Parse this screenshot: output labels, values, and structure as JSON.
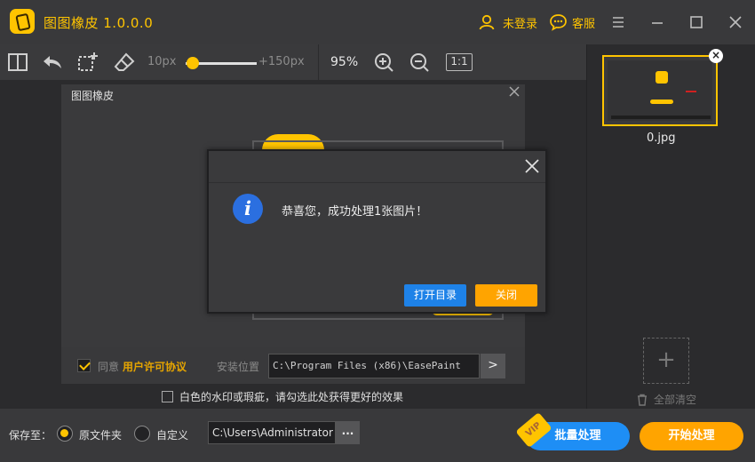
{
  "app": {
    "title": "图图橡皮 1.0.0.0"
  },
  "titlebar": {
    "login_label": "未登录",
    "service_label": "客服"
  },
  "toolbar": {
    "brush_min": "10px",
    "brush_max": "+150px",
    "brush_level": 0.1,
    "zoom": "95%",
    "ratio_label": "1:1"
  },
  "inner_dialog": {
    "title": "图图橡皮",
    "agree_prefix": "同意",
    "license_link": "用户许可协议",
    "install_label": "安装位置",
    "install_path": "C:\\Program Files (x86)\\EasePaint",
    "install_browse": ">"
  },
  "watermark_hint": "白色的水印或瑕疵，请勾选此处获得更好的效果",
  "right_panel": {
    "thumbnail_name": "0.jpg",
    "add_label": "+",
    "clear_all": "全部清空"
  },
  "bottombar": {
    "save_label": "保存至：",
    "option_original": "原文件夹",
    "option_custom": "自定义",
    "output_path": "C:\\Users\\Administrator",
    "output_browse": "...",
    "batch_label": "批量处理",
    "vip_label": "VIP",
    "start_label": "开始处理"
  },
  "modal": {
    "message": "恭喜您，成功处理1张图片！",
    "open_dir_label": "打开目录",
    "close_label": "关闭"
  },
  "colors": {
    "accent": "#ffc400",
    "primary_blue": "#1e82e8",
    "orange": "#ffa400"
  }
}
